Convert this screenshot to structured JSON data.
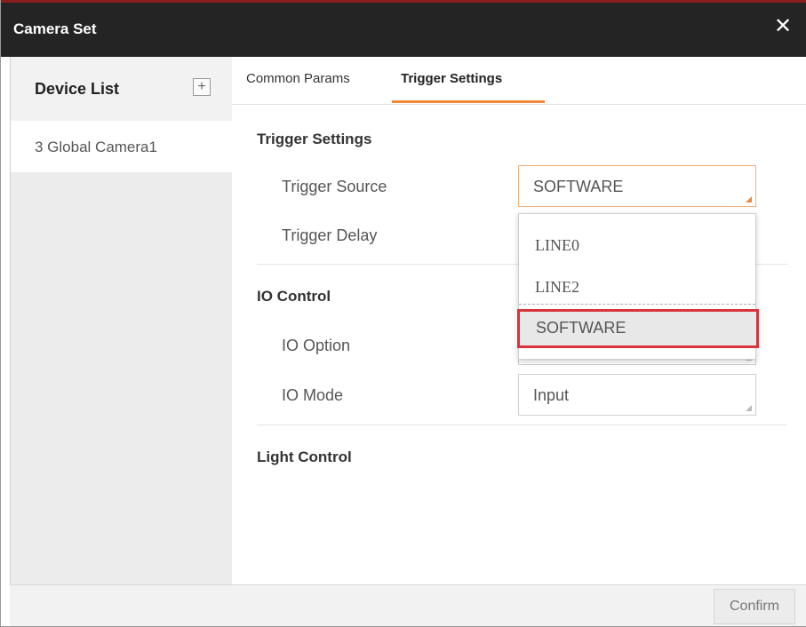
{
  "window": {
    "title": "Camera Set",
    "close_glyph": "✕"
  },
  "sidebar": {
    "title": "Device List",
    "add_glyph": "+",
    "devices": [
      {
        "label": "3  Global Camera1"
      }
    ]
  },
  "tabs": [
    {
      "label": "Common Params",
      "active": false
    },
    {
      "label": "Trigger Settings",
      "active": true
    }
  ],
  "trigger_settings": {
    "section_title": "Trigger Settings",
    "source_label": "Trigger Source",
    "source_value": "SOFTWARE",
    "delay_label": "Trigger Delay"
  },
  "dropdown": {
    "options": [
      "LINE0",
      "LINE2",
      "SOFTWARE"
    ],
    "highlighted": "SOFTWARE"
  },
  "io_control": {
    "section_title": "IO Control",
    "option_label": "IO Option",
    "mode_label": "IO Mode",
    "mode_value": "Input"
  },
  "light_control": {
    "section_title": "Light Control"
  },
  "footer": {
    "confirm_label": "Confirm"
  },
  "colors": {
    "titlebar": "#242424",
    "accent_orange": "#f08a3c",
    "highlight_red": "#d9333b"
  }
}
